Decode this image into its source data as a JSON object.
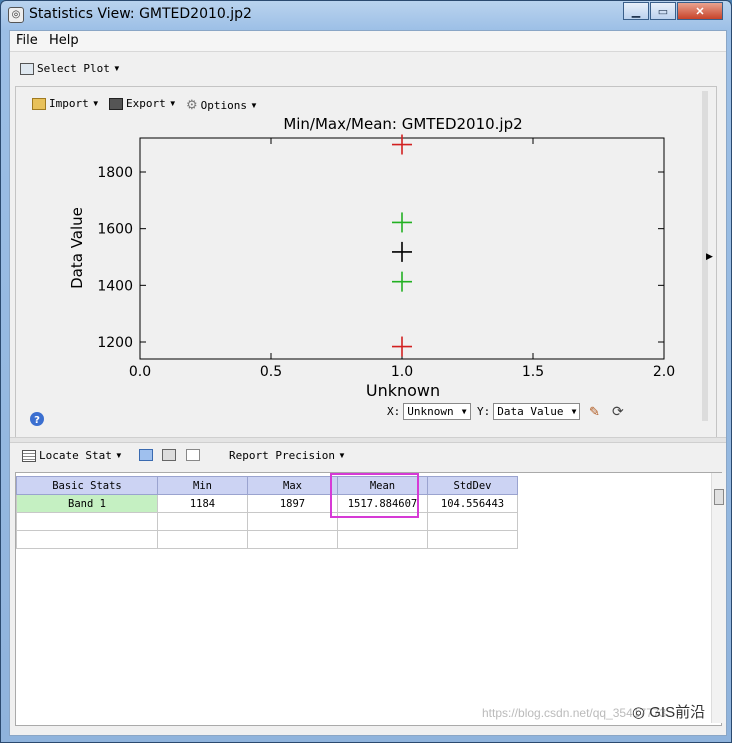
{
  "window": {
    "title": "Statistics View: GMTED2010.jp2",
    "app_icon": "app-icon"
  },
  "menu": {
    "items": [
      "File",
      "Help"
    ]
  },
  "toolbar": {
    "select_plot": "Select Plot"
  },
  "plot_toolbar": {
    "import": "Import",
    "export": "Export",
    "options": "Options"
  },
  "chart_data": {
    "type": "scatter",
    "title": "Min/Max/Mean: GMTED2010.jp2",
    "xlabel": "Unknown",
    "ylabel": "Data Value",
    "xlim": [
      0.0,
      2.0
    ],
    "ylim": [
      1140,
      1920
    ],
    "xticks": [
      "0.0",
      "0.5",
      "1.0",
      "1.5",
      "2.0"
    ],
    "yticks": [
      "1200",
      "1400",
      "1600",
      "1800"
    ],
    "marker": "plus",
    "series": [
      {
        "color": "#d22020",
        "points": [
          [
            1.0,
            1897
          ],
          [
            1.0,
            1184
          ]
        ]
      },
      {
        "color": "#22b022",
        "points": [
          [
            1.0,
            1622
          ],
          [
            1.0,
            1413
          ]
        ]
      },
      {
        "color": "#000000",
        "points": [
          [
            1.0,
            1518
          ]
        ]
      }
    ]
  },
  "axis_select": {
    "x_label": "X:",
    "x_value": "Unknown",
    "y_label": "Y:",
    "y_value": "Data Value"
  },
  "stat_toolbar": {
    "locate": "Locate Stat",
    "precision": "Report Precision"
  },
  "table": {
    "headers": [
      "Basic Stats",
      "Min",
      "Max",
      "Mean",
      "StdDev"
    ],
    "rows": [
      [
        "Band 1",
        "1184",
        "1897",
        "1517.884607",
        "104.556443"
      ]
    ]
  },
  "watermarks": {
    "csdn": "https://blog.csdn.net/qq_35417773",
    "brand": "GIS前沿"
  }
}
